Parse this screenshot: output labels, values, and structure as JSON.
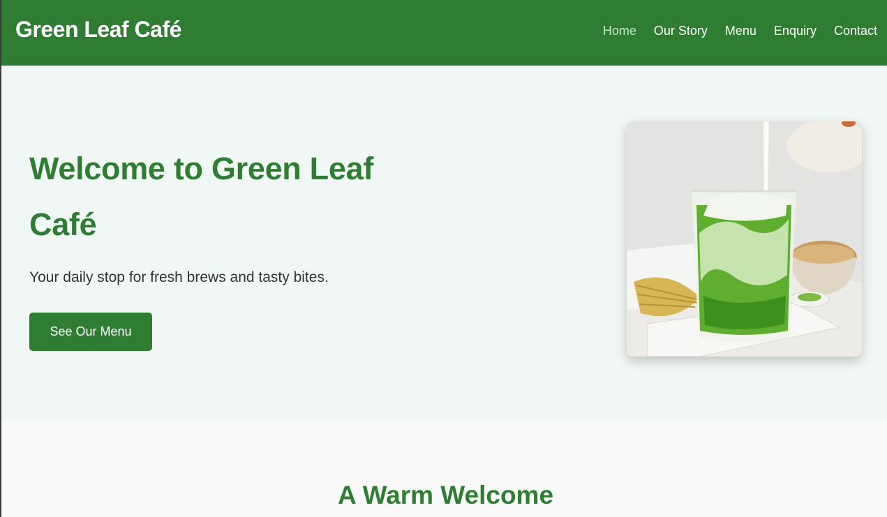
{
  "site": {
    "brand": "Green Leaf Café"
  },
  "nav": {
    "items": [
      {
        "label": "Home",
        "active": true
      },
      {
        "label": "Our Story",
        "active": false
      },
      {
        "label": "Menu",
        "active": false
      },
      {
        "label": "Enquiry",
        "active": false
      },
      {
        "label": "Contact",
        "active": false
      }
    ]
  },
  "hero": {
    "title": "Welcome to Green Leaf Café",
    "subtitle": "Your daily stop for fresh brews and tasty bites.",
    "cta_label": "See Our Menu",
    "image": "matcha-latte-photo"
  },
  "welcome": {
    "title": "A Warm Welcome"
  },
  "colors": {
    "primary": "#2e7d32",
    "hero_bg": "#f1f7f4",
    "nav_active": "#c8e6c9",
    "text": "#333333"
  }
}
